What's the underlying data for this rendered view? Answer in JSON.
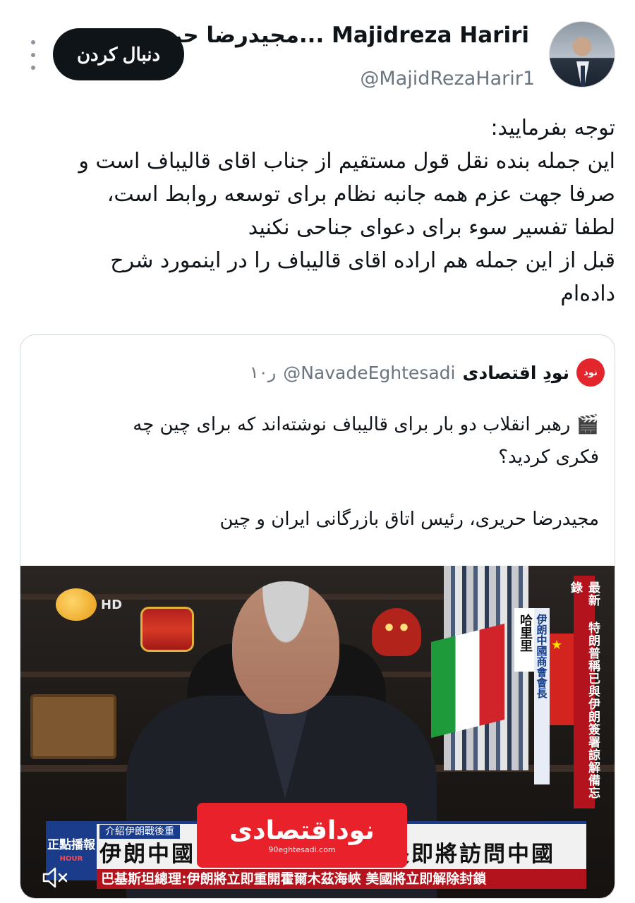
{
  "author": {
    "display_name": "مجیدرضا حر... Majidreza Hariri",
    "handle": "@MajidRezaHarir1",
    "follow_label": "دنبال کردن"
  },
  "tweet": {
    "lines": [
      "توجه بفرمایید:",
      "این جمله بنده نقل قول مستقیم از جناب اقای قالیباف است و",
      "صرفا جهت عزم همه جانبه نظام برای توسعه روابط است،",
      "لطفا تفسیر سوء برای دعوای جناحی نکنید",
      "قبل از این جمله هم اراده اقای قالیباف را در اینمورد شرح",
      "داده‌ام"
    ]
  },
  "quote": {
    "avatar_label": "نود",
    "name": "نودِ اقتصادی",
    "handle": "@NavadeEghtesadi",
    "time": "۱۰ر",
    "line1": "🎬 رهبر انقلاب دو بار برای قالیباف نوشته‌اند که برای چین چه",
    "line2": "فکری کردید؟",
    "line3": "مجیدرضا حریری، رئیس اتاق بازرگانی ایران و چین"
  },
  "video": {
    "logo": "HD",
    "name_bar": "哈里里",
    "title_bar": "伊朗中國商會會長",
    "news_bar": "最新 特朗普稱已與伊朗簽署諒解備忘錄",
    "ticker_tag": "正點播報",
    "ticker_tag_sub": "HOUR",
    "ticker_head": "介紹伊朗戰後重",
    "ticker_line1": "伊朗中國　　　　　　　　長即將訪問中國",
    "ticker_line2": "巴基斯坦總理:伊朗將立即重開霍爾木茲海峽 美國將立即解除封鎖",
    "watermark": "نوداقتصادی",
    "watermark_url": "90eghtesadi.com"
  }
}
